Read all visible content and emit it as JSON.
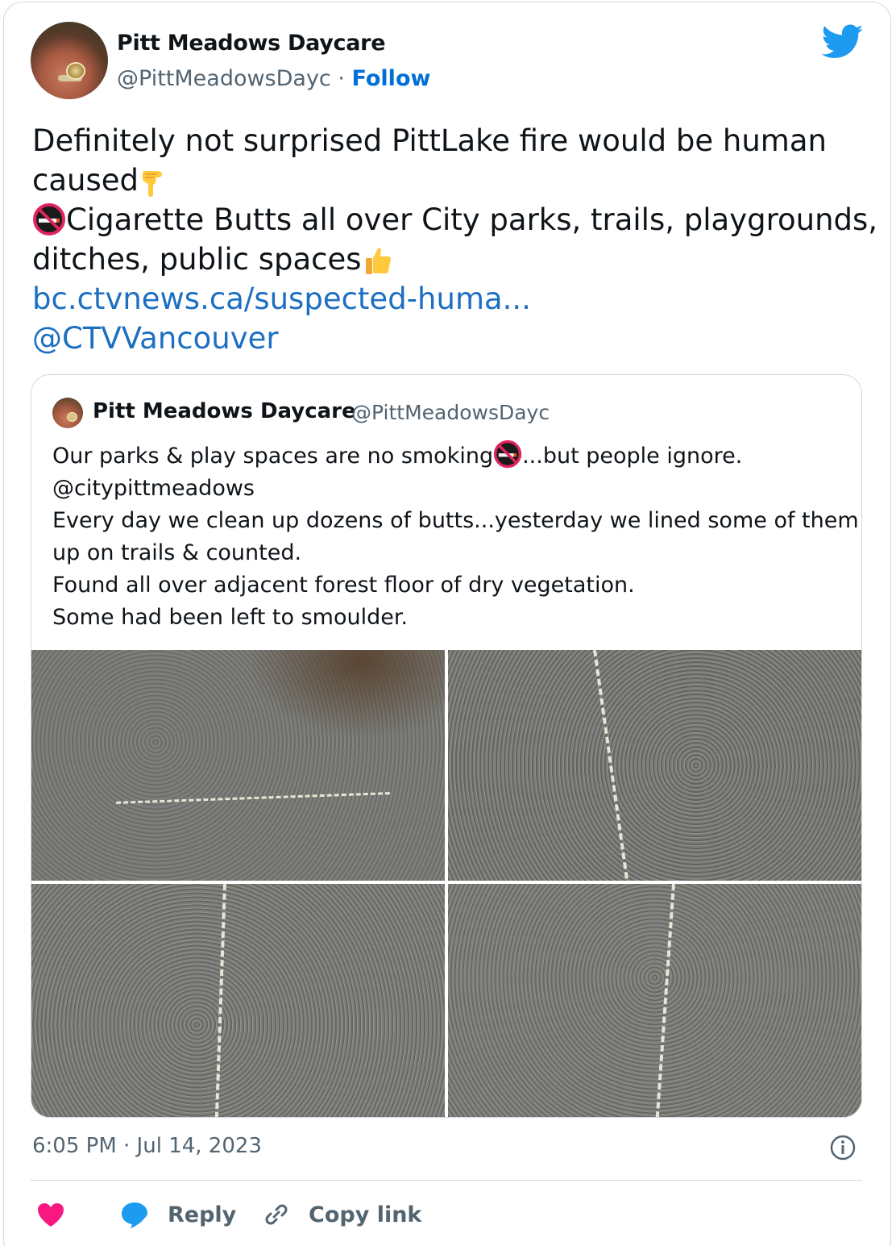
{
  "author": {
    "name": "Pitt Meadows Daycare",
    "handle": "@PittMeadowsDayc",
    "separator": " · ",
    "follow_label": "Follow"
  },
  "tweet": {
    "line1": "Definitely not surprised PittLake fire would be human",
    "line2": "caused",
    "line3": "Cigarette Butts all over City parks, trails, playgrounds,",
    "line4": "ditches, public spaces",
    "link": "bc.ctvnews.ca/suspected-huma...",
    "mention": "@CTVVancouver"
  },
  "quote": {
    "name": "Pitt Meadows Daycare",
    "handle": "@PittMeadowsDayc",
    "line1_a": "Our parks & play spaces are  no smoking",
    "line1_b": "...but people ignore.",
    "line2": "@citypittmeadows",
    "line3": "Every day we clean up dozens of butts...yesterday we lined some of them",
    "line4": "up on trails & counted.",
    "line5": "Found all over adjacent forest floor of dry vegetation.",
    "line6": "Some had been left to smoulder."
  },
  "footer": {
    "timestamp": "6:05 PM · Jul 14, 2023",
    "reply_label": "Reply",
    "copy_link_label": "Copy link"
  },
  "colors": {
    "twitter_blue": "#1d9bf0",
    "link_blue": "#1d6fc2",
    "like_pink": "#f91880",
    "muted_gray": "#536471"
  },
  "icons": [
    "twitter-bird-icon",
    "point-down-emoji-icon",
    "no-smoking-icon",
    "thumbs-up-emoji-icon",
    "info-icon",
    "heart-icon",
    "reply-bubble-icon",
    "link-icon"
  ]
}
